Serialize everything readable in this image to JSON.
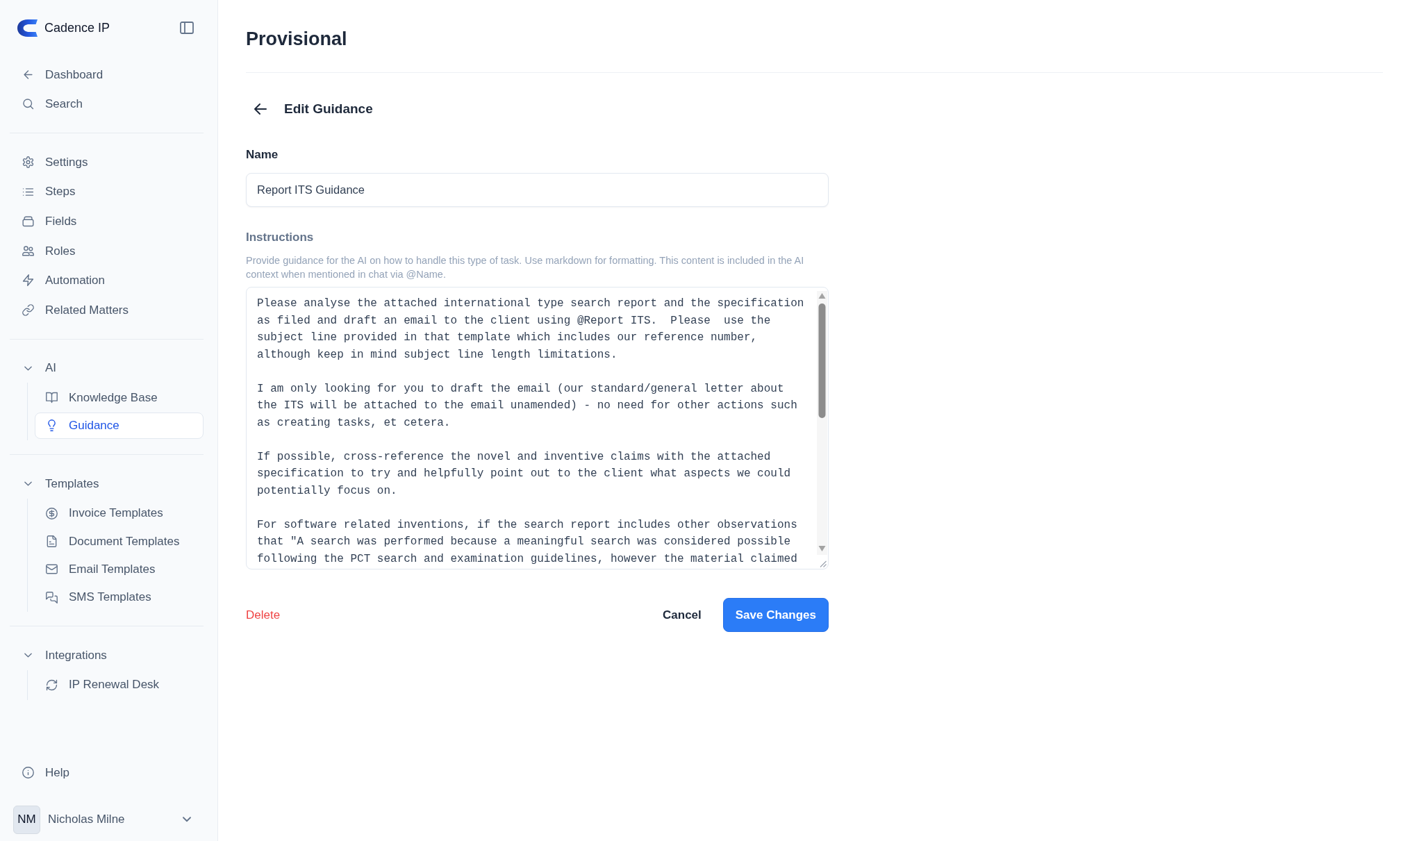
{
  "sidebar": {
    "brand": "Cadence IP",
    "top_items": [
      {
        "label": "Dashboard",
        "selected": false
      },
      {
        "label": "Search",
        "selected": false
      }
    ],
    "config_items": [
      {
        "label": "Settings",
        "selected": false
      },
      {
        "label": "Steps",
        "selected": false
      },
      {
        "label": "Fields",
        "selected": false
      },
      {
        "label": "Roles",
        "selected": false
      },
      {
        "label": "Automation",
        "selected": false
      },
      {
        "label": "Related Matters",
        "selected": false
      }
    ],
    "groups": [
      {
        "label": "AI",
        "expanded": true,
        "items": [
          {
            "label": "Knowledge Base",
            "selected": false
          },
          {
            "label": "Guidance",
            "selected": true
          }
        ]
      },
      {
        "label": "Templates",
        "expanded": true,
        "items": [
          {
            "label": "Invoice Templates",
            "selected": false
          },
          {
            "label": "Document Templates",
            "selected": false
          },
          {
            "label": "Email Templates",
            "selected": false
          },
          {
            "label": "SMS Templates",
            "selected": false
          }
        ]
      },
      {
        "label": "Integrations",
        "expanded": true,
        "items": [
          {
            "label": "IP Renewal Desk",
            "selected": false
          }
        ]
      }
    ],
    "help": "Help",
    "user": {
      "initials": "NM",
      "name": "Nicholas Milne"
    }
  },
  "page": {
    "title": "Provisional"
  },
  "form": {
    "heading": "Edit Guidance",
    "name_field": {
      "label": "Name",
      "value": "Report ITS Guidance"
    },
    "instructions_field": {
      "label": "Instructions",
      "help": "Provide guidance for the AI on how to handle this type of task. Use markdown for formatting. This content is included in the AI context when mentioned in chat via @Name.",
      "value": "Please analyse the attached international type search report and the specification as filed and draft an email to the client using @Report ITS.  Please  use the subject line provided in that template which includes our reference number, although keep in mind subject line length limitations.\n\nI am only looking for you to draft the email (our standard/general letter about the ITS will be attached to the email unamended) - no need for other actions such as creating tasks, et cetera.\n\nIf possible, cross-reference the novel and inventive claims with the attached specification to try and helpfully point out to the client what aspects we could potentially focus on.\n\nFor software related inventions, if the search report includes other observations that \"A search was performed because a meaningful search was considered possible following the PCT search and examination guidelines, however the material claimed"
    },
    "actions": [
      {
        "label": "Delete",
        "kind": "danger"
      },
      {
        "label": "Cancel",
        "kind": "secondary"
      },
      {
        "label": "Save Changes",
        "kind": "primary"
      }
    ]
  }
}
